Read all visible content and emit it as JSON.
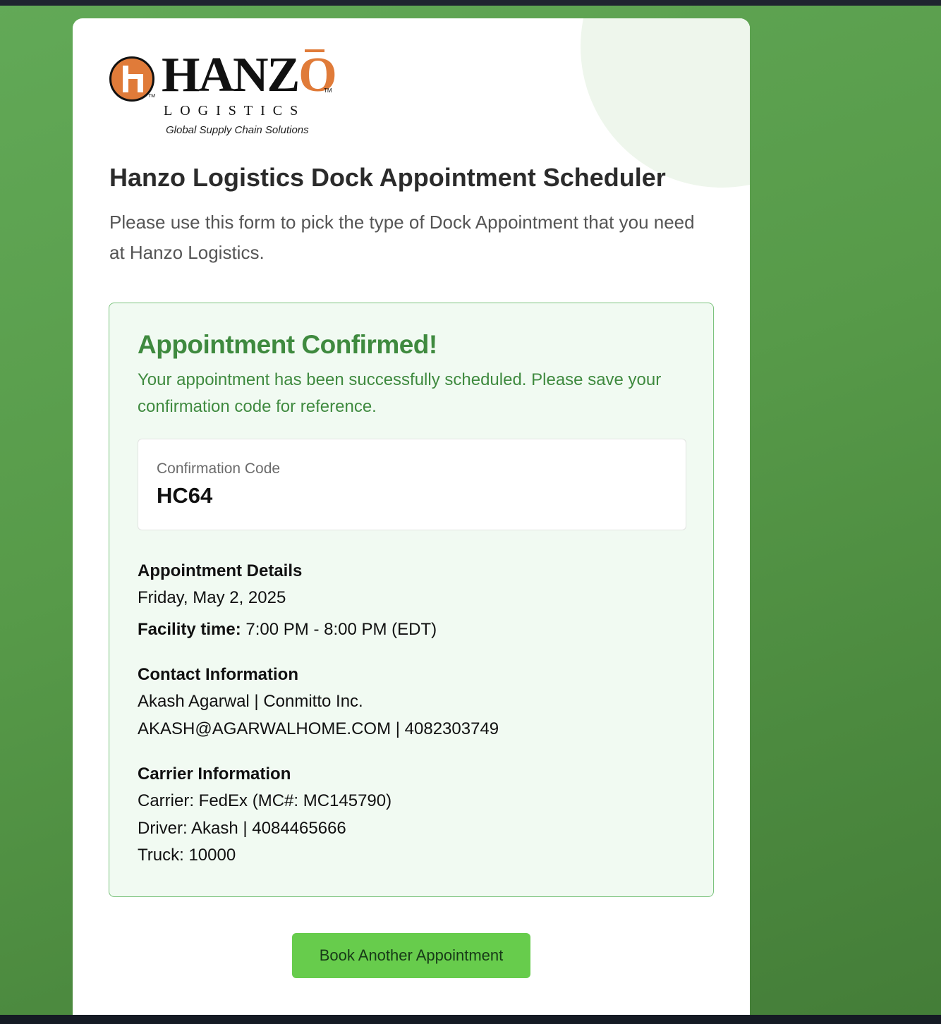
{
  "logo": {
    "name_prefix": "HANZ",
    "name_o": "O",
    "tm": "TM",
    "subtitle": "LOGISTICS",
    "tagline": "Global Supply Chain Solutions"
  },
  "header": {
    "title": "Hanzo Logistics Dock Appointment Scheduler",
    "intro": "Please use this form to pick the type of Dock Appointment that you need at Hanzo Logistics."
  },
  "confirmation": {
    "title": "Appointment Confirmed!",
    "message": "Your appointment has been successfully scheduled. Please save your confirmation code for reference.",
    "code_label": "Confirmation Code",
    "code": "HC64"
  },
  "details": {
    "heading": "Appointment Details",
    "date": "Friday, May 2, 2025",
    "facility_label": "Facility time:",
    "facility_time": "7:00 PM - 8:00 PM (EDT)"
  },
  "contact": {
    "heading": "Contact Information",
    "name_company": "Akash Agarwal | Conmitto Inc.",
    "email_phone": "AKASH@AGARWALHOME.COM | 4082303749"
  },
  "carrier": {
    "heading": "Carrier Information",
    "carrier": "Carrier: FedEx (MC#: MC145790)",
    "driver": "Driver: Akash | 4084465666",
    "truck": "Truck: 10000"
  },
  "actions": {
    "book_another": "Book Another Appointment"
  },
  "colors": {
    "background_green": "#579a49",
    "success_green": "#3f8a3f",
    "button_green": "#67cc4c",
    "logo_orange": "#e07b39"
  }
}
